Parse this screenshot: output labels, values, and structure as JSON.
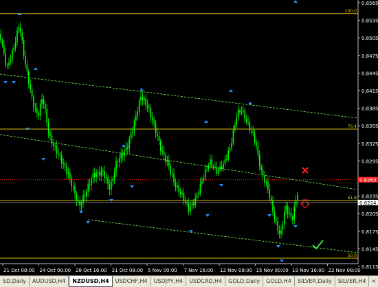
{
  "chart": {
    "price_ticks": [
      "0.8565",
      "0.8535",
      "0.8505",
      "0.8475",
      "0.8445",
      "0.8415",
      "0.8385",
      "0.8355",
      "0.8325",
      "0.8295",
      "0.8265",
      "0.8235",
      "0.8205",
      "0.8175",
      "0.8145",
      "0.8115"
    ],
    "time_ticks": [
      "21 Oct 08:00",
      "24 Oct 00:00",
      "28 Oct 16:00",
      "31 Oct 08:00",
      "5 Nov 00:00",
      "7 Nov 16:00",
      "12 Nov 08:00",
      "15 Nov 00:00",
      "19 Nov 16:00",
      "22 Nov 08:00"
    ],
    "fib_levels": [
      {
        "label": "100.0",
        "price": 0.85465
      },
      {
        "label": "76.4",
        "price": 0.83494
      },
      {
        "label": "61.8",
        "price": 0.82275
      },
      {
        "label": "50.0",
        "price": 0.8129
      }
    ],
    "current_price": "0.8224",
    "red_level_price": "0.8263",
    "colors": {
      "background": "#000000",
      "candle": "#00ff00",
      "fractal": "#1e90ff",
      "fib": "#e5c000",
      "channel": "#7fff50",
      "current_box": "#ffffff",
      "red_level": "#ff2020"
    },
    "markers": {
      "sell_icon": "red-x",
      "arrow_icon": "red-down-arrow",
      "target_icon": "green-checkmark"
    }
  },
  "tabs": [
    {
      "label": "SD,Daily",
      "active": false
    },
    {
      "label": "AUDUSD,H4",
      "active": false
    },
    {
      "label": "NZDUSD,H4",
      "active": true
    },
    {
      "label": "USDCHF,H4",
      "active": false
    },
    {
      "label": "USDJPY,H4",
      "active": false
    },
    {
      "label": "USDCAD,H4",
      "active": false
    },
    {
      "label": "GOLD,Daily",
      "active": false
    },
    {
      "label": "GOLD,H4",
      "active": false
    },
    {
      "label": "SILVER,Daily",
      "active": false
    },
    {
      "label": "SILVER,H4",
      "active": false
    }
  ],
  "nav": {
    "left": "<",
    "right": ">"
  }
}
